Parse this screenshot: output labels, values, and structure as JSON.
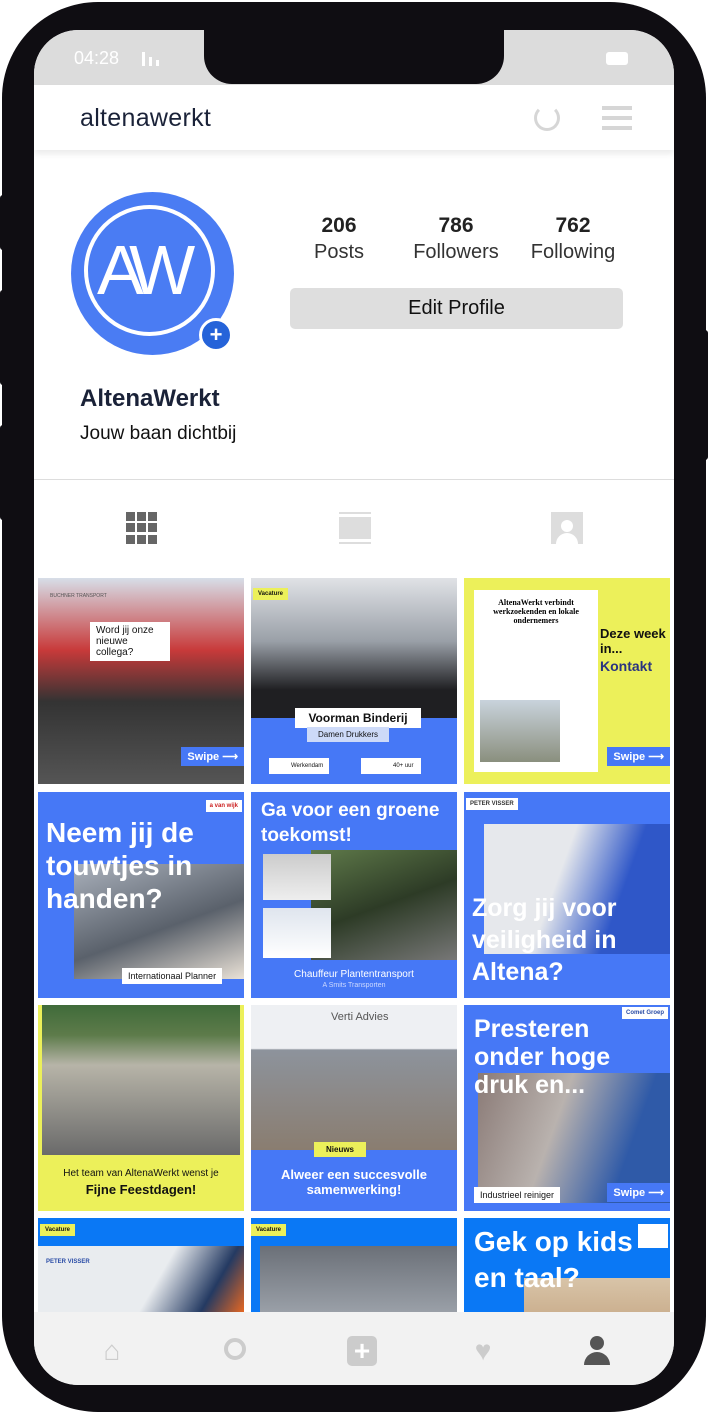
{
  "status": {
    "time": "04:28"
  },
  "header": {
    "title": "altenawerkt",
    "refresh_icon": "refresh-icon",
    "menu_icon": "hamburger-menu-icon"
  },
  "profile": {
    "avatar_text": "AW",
    "name": "AltenaWerkt",
    "bio": "Jouw baan dichtbij",
    "edit_label": "Edit Profile",
    "stats": [
      {
        "value": "206",
        "label": "Posts"
      },
      {
        "value": "786",
        "label": "Followers"
      },
      {
        "value": "762",
        "label": "Following"
      }
    ]
  },
  "colors": {
    "brand_blue": "#4678f6",
    "brand_yellow": "#ecf05a",
    "dark": "#1a2238"
  },
  "posts": [
    {
      "bubble": "Word jij onze nieuwe collega?",
      "truck": "BUCHNER TRANSPORT",
      "swipe": "Swipe ⟶"
    },
    {
      "tag": "Vacature",
      "title": "Voorman Binderij",
      "company": "Damen Drukkers",
      "location": "Werkendam",
      "hours": "40+ uur"
    },
    {
      "headline": "AltenaWerkt verbindt werkzoekenden en lokale ondernemers",
      "text": "Deze week in...",
      "brand": "Kontakt",
      "swipe": "Swipe ⟶"
    },
    {
      "logo": "a van wijk",
      "text": "Neem jij de touwtjes in handen?",
      "label": "Internationaal Planner"
    },
    {
      "text": "Ga voor een groene toekomst!",
      "role": "Chauffeur Plantentransport",
      "company": "A Smits Transporten"
    },
    {
      "logo": "PETER VISSER",
      "text": "Zorg jij voor veiligheid in Altena?"
    },
    {
      "line1": "Het team van AltenaWerkt wenst je",
      "line2": "Fijne Feestdagen!"
    },
    {
      "sign": "Verti Advies",
      "tag": "Nieuws",
      "text": "Alweer een succesvolle samenwerking!"
    },
    {
      "logo": "Comet Groep",
      "text": "Presteren onder hoge druk en...",
      "label": "Industrieel reiniger",
      "swipe": "Swipe ⟶"
    },
    {
      "tag": "Vacature",
      "logo": "PETER VISSER"
    },
    {
      "tag": "Vacature"
    },
    {
      "text": "Gek op kids en taal?"
    }
  ]
}
